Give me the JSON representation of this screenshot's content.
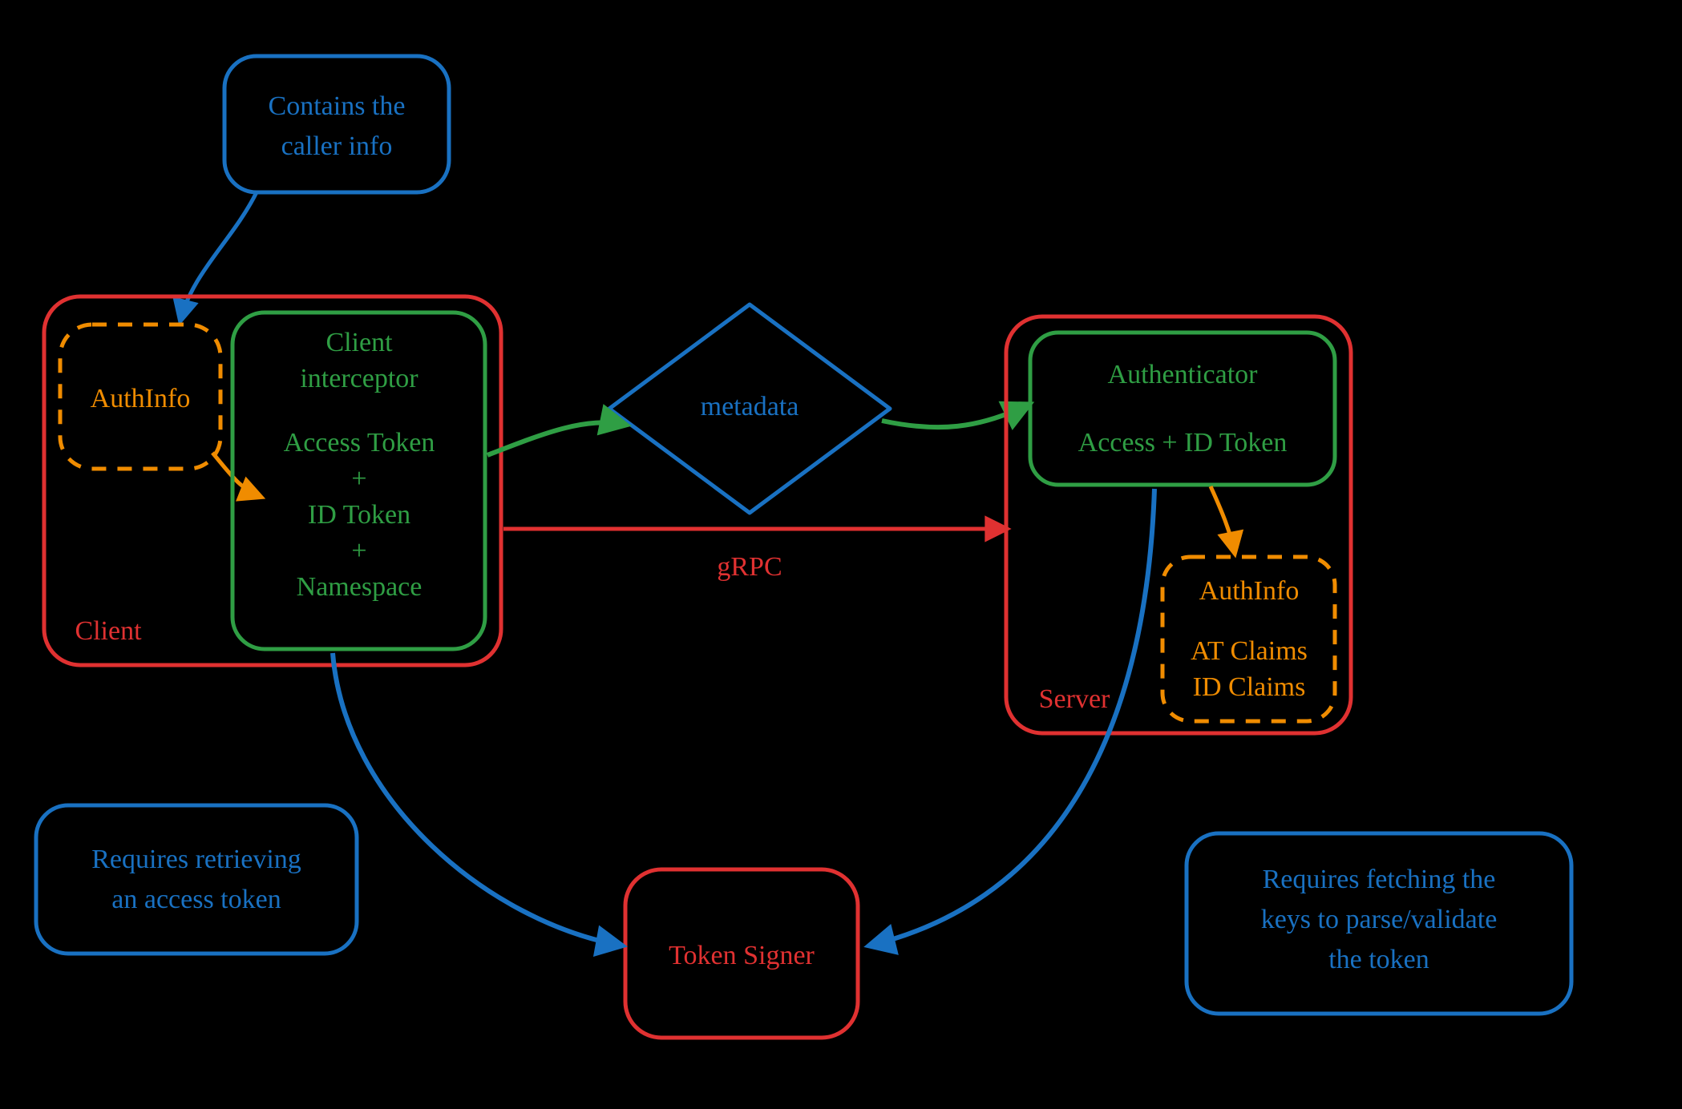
{
  "colors": {
    "blue": "#1971c2",
    "green": "#2f9e44",
    "red": "#e03131",
    "orange": "#f08c00",
    "bg": "#000000"
  },
  "nodes": {
    "client_label": "Client",
    "server_label": "Server",
    "authinfo_client": "AuthInfo",
    "client_interceptor": {
      "title": "Client interceptor",
      "line1": "Access Token",
      "plus1": "+",
      "line2": "ID Token",
      "plus2": "+",
      "line3": "Namespace"
    },
    "metadata": "metadata",
    "grpc": "gRPC",
    "authenticator": {
      "title": "Authenticator",
      "line1": "Access + ID Token"
    },
    "authinfo_server": {
      "title": "AuthInfo",
      "line1": "AT Claims",
      "line2": "ID Claims"
    },
    "token_signer": "Token Signer"
  },
  "callouts": {
    "top": {
      "line1": "Contains the",
      "line2": "caller info"
    },
    "left": {
      "line1": "Requires retrieving",
      "line2": "an access token"
    },
    "right": {
      "line1": "Requires fetching the",
      "line2": "keys to parse/validate",
      "line3": "the token"
    }
  }
}
